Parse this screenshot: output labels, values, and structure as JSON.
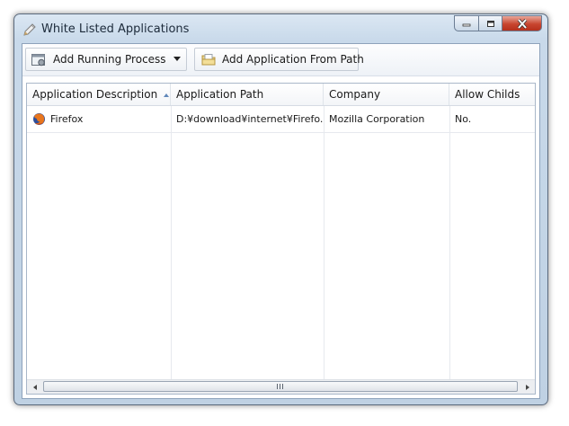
{
  "window": {
    "title": "White Listed Applications",
    "icons": {
      "app": "pencil-icon",
      "minimize": "minimize-icon",
      "maximize": "maximize-icon",
      "close": "close-icon"
    }
  },
  "toolbar": {
    "add_running_process_label": "Add Running Process",
    "add_application_from_path_label": "Add Application From Path",
    "icons": {
      "running": "process-window-icon",
      "path": "folder-icon",
      "dropdown": "chevron-down-icon"
    }
  },
  "table": {
    "columns": [
      "Application Description",
      "Application Path",
      "Company",
      "Allow Childs"
    ],
    "sorted_column": "Application Description",
    "sort_direction": "ascending",
    "rows": [
      {
        "description": "Firefox",
        "path": "D:¥download¥internet¥Firefo...",
        "company": "Mozilla Corporation",
        "allow_childs": "No.",
        "icon": "firefox-icon"
      }
    ]
  },
  "scrollbar": {
    "grip": "III"
  },
  "colors": {
    "accent": "#5f87b9",
    "close_button": "#c8452f",
    "frame": "#c8d9ea"
  }
}
